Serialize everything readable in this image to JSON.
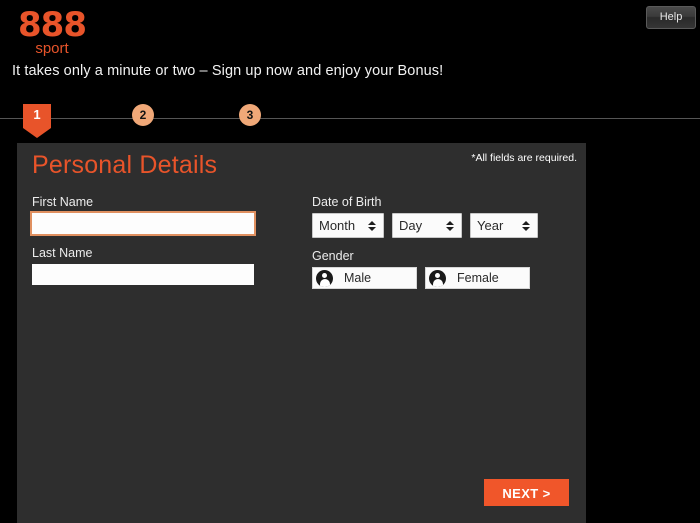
{
  "brand": {
    "logo_main": "888",
    "logo_sub": "sport",
    "accent_orange": "#e8542a",
    "button_orange": "#f0562a",
    "step_peach": "#f0a878",
    "panel_bg": "#2e2e2e",
    "page_bg": "#000000"
  },
  "header": {
    "help_label": "Help",
    "tagline": "It takes only a minute or two – Sign up now and enjoy your Bonus!"
  },
  "steps": [
    {
      "number": "1",
      "state": "active"
    },
    {
      "number": "2",
      "state": "inactive"
    },
    {
      "number": "3",
      "state": "inactive"
    }
  ],
  "panel": {
    "title": "Personal Details",
    "required_note": "*All fields are required."
  },
  "form": {
    "first_name": {
      "label": "First Name",
      "value": "",
      "placeholder": "",
      "focused": true
    },
    "last_name": {
      "label": "Last Name",
      "value": "",
      "placeholder": "",
      "focused": false
    },
    "date_of_birth": {
      "label": "Date of Birth",
      "month": {
        "selected": "Month"
      },
      "day": {
        "selected": "Day"
      },
      "year": {
        "selected": "Year"
      }
    },
    "gender": {
      "label": "Gender",
      "options": [
        {
          "label": "Male",
          "icon": "person-icon"
        },
        {
          "label": "Female",
          "icon": "person-icon"
        }
      ]
    }
  },
  "footer": {
    "next_label": "NEXT >"
  }
}
